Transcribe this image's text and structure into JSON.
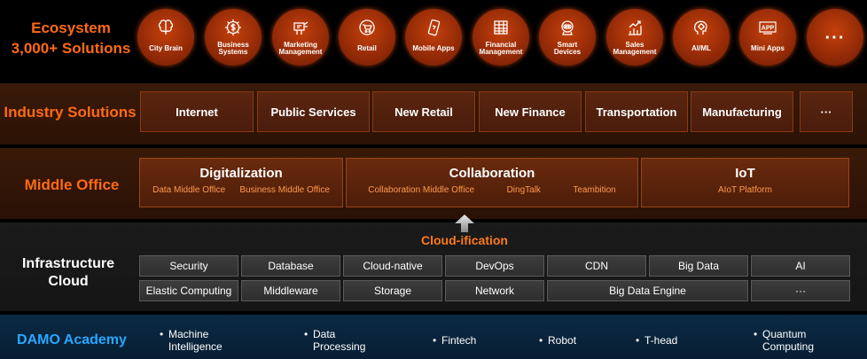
{
  "ecosystem": {
    "title_line1": "Ecosystem",
    "title_line2": "3,000+ Solutions",
    "items": [
      {
        "label": "City Brain",
        "icon": "brain-icon"
      },
      {
        "label": "Business\nSystems",
        "icon": "dollar-gear-icon"
      },
      {
        "label": "Marketing\nManagement",
        "icon": "billboard-icon"
      },
      {
        "label": "Retail",
        "icon": "cart-icon"
      },
      {
        "label": "Mobile Apps",
        "icon": "phone-icon"
      },
      {
        "label": "Financial\nManagement",
        "icon": "ledger-icon"
      },
      {
        "label": "Smart\nDevices",
        "icon": "robot-icon"
      },
      {
        "label": "Sales\nManagement",
        "icon": "bar-chart-icon"
      },
      {
        "label": "AI/ML",
        "icon": "ai-head-icon"
      },
      {
        "label": "Mini Apps",
        "icon": "app-icon"
      }
    ],
    "more": "···",
    "app_icon_text": "APP"
  },
  "industry": {
    "title": "Industry Solutions",
    "items": [
      "Internet",
      "Public Services",
      "New Retail",
      "New Finance",
      "Transportation",
      "Manufacturing",
      "···"
    ]
  },
  "middle": {
    "title": "Middle Office",
    "groups": [
      {
        "name": "Digitalization",
        "subs": [
          "Data Middle Office",
          "Business Middle Office"
        ]
      },
      {
        "name": "Collaboration",
        "subs": [
          "Collaboration Middle Office",
          "DingTalk",
          "Teambition"
        ]
      },
      {
        "name": "IoT",
        "subs": [
          "AIoT Platform"
        ]
      }
    ]
  },
  "cloudify": "Cloud-ification",
  "infra": {
    "title_line1": "Infrastructure",
    "title_line2": "Cloud",
    "row1": [
      "Security",
      "Database",
      "Cloud-native",
      "DevOps",
      "CDN",
      "Big Data",
      "AI"
    ],
    "row2": [
      "Elastic Computing",
      "Middleware",
      "Storage",
      "Network",
      "Big Data Engine",
      "···"
    ]
  },
  "damo": {
    "title": "DAMO Academy",
    "bullet": "•",
    "items": [
      "Machine\nIntelligence",
      "Data\nProcessing",
      "Fintech",
      "Robot",
      "T-head",
      "Quantum\nComputing"
    ]
  },
  "colors": {
    "orange": "#ff6a14",
    "blue": "#2aa7ff"
  }
}
